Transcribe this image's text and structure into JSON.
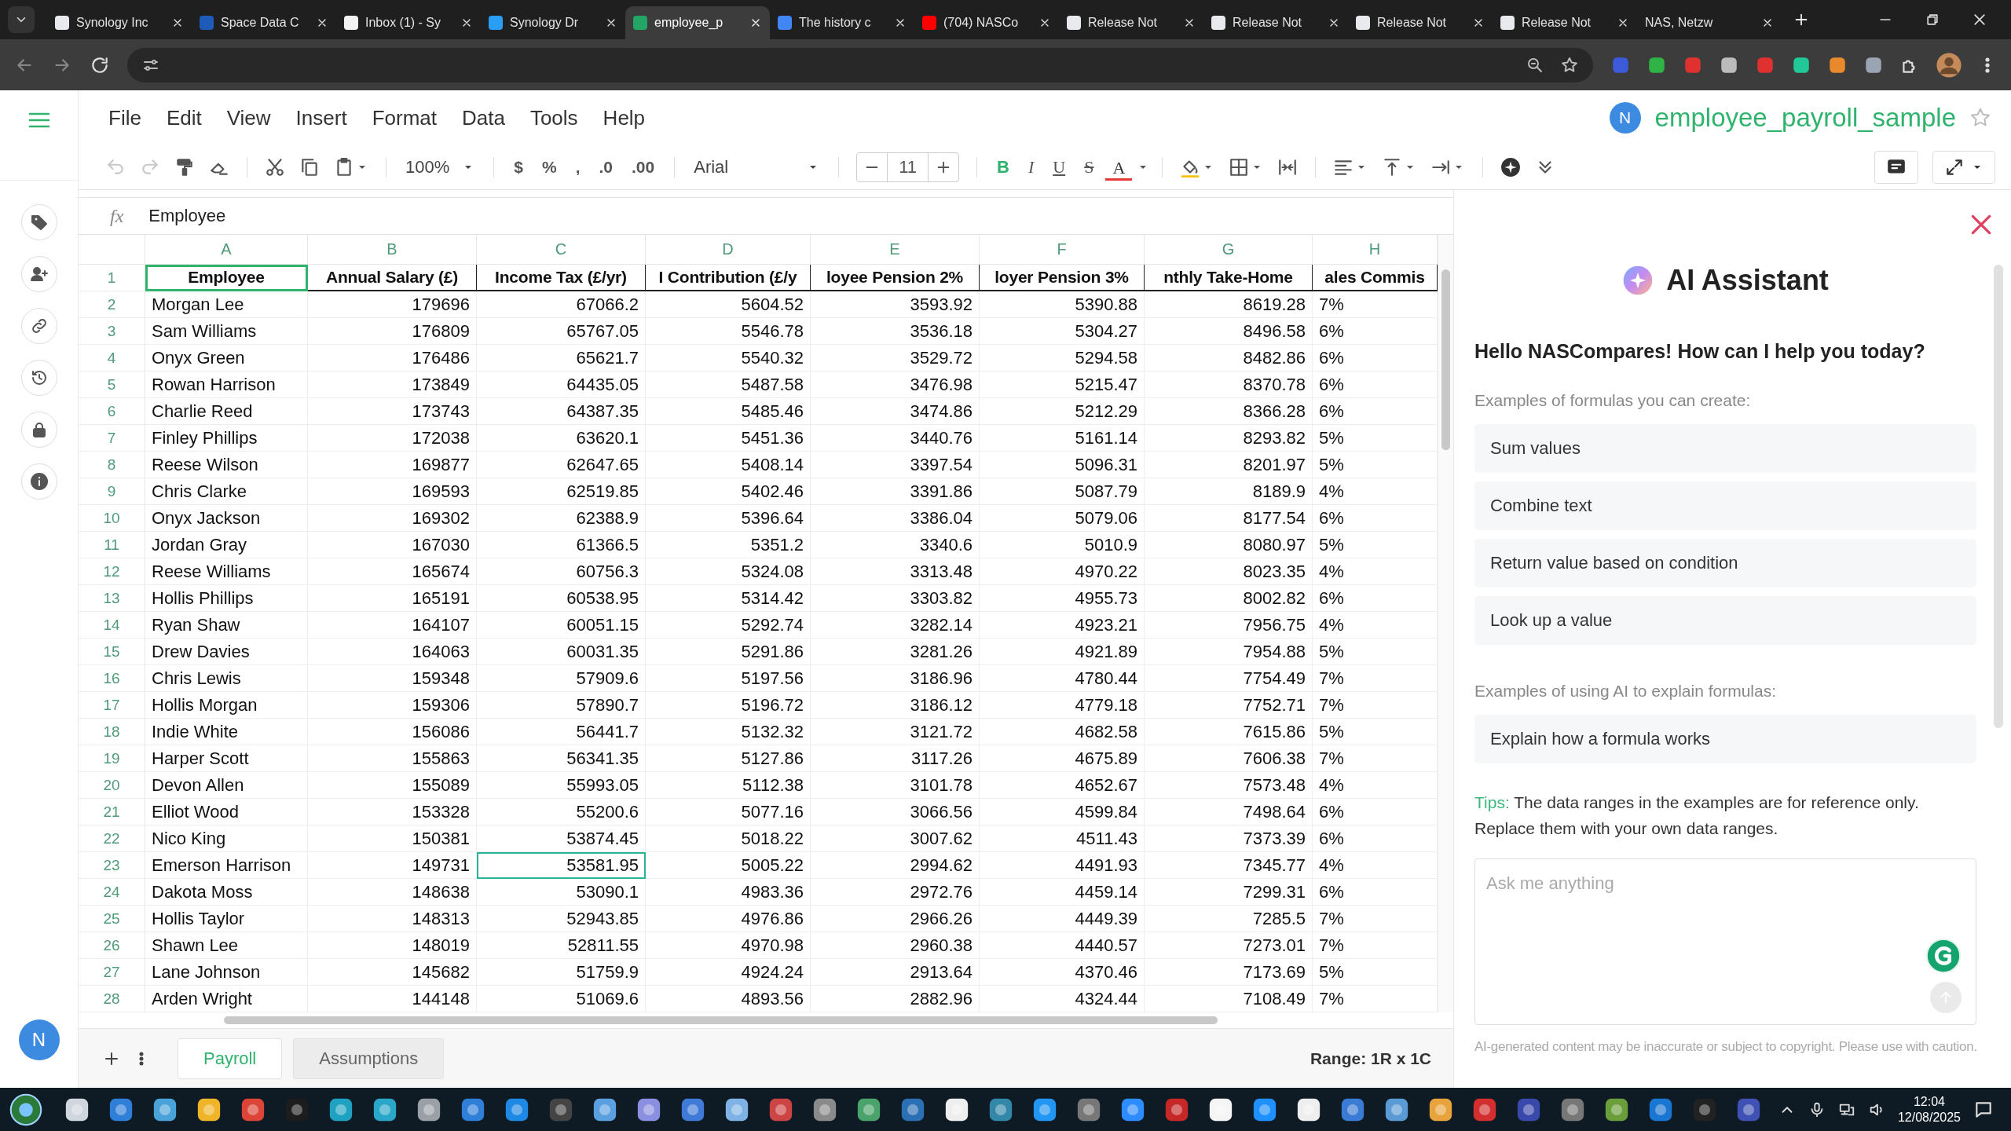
{
  "browser": {
    "tabs": [
      {
        "title": "Synology Inc",
        "selected": false,
        "color": "#e8eaed"
      },
      {
        "title": "Space Data C",
        "selected": false,
        "color": "#1e5bb8"
      },
      {
        "title": "Inbox (1) - Sy",
        "selected": false,
        "color": "#f1f3f4"
      },
      {
        "title": "Synology Dr",
        "selected": false,
        "color": "#2a9ef4"
      },
      {
        "title": "employee_p",
        "selected": true,
        "color": "#23a566"
      },
      {
        "title": "The history c",
        "selected": false,
        "color": "#4285f4"
      },
      {
        "title": "(704) NASCo",
        "selected": false,
        "color": "#ff0000"
      },
      {
        "title": "Release Not",
        "selected": false,
        "color": "#e8eaed"
      },
      {
        "title": "Release Not",
        "selected": false,
        "color": "#e8eaed"
      },
      {
        "title": "Release Not",
        "selected": false,
        "color": "#e8eaed"
      },
      {
        "title": "Release Not",
        "selected": false,
        "color": "#e8eaed"
      },
      {
        "title": "NAS, Netzw",
        "selected": false
      }
    ]
  },
  "app": {
    "menu": [
      "File",
      "Edit",
      "View",
      "Insert",
      "Format",
      "Data",
      "Tools",
      "Help"
    ],
    "rail_user_initial": "N",
    "user_initial": "N",
    "document_title": "employee_payroll_sample",
    "toolbar": {
      "undo": {
        "disabled": true
      },
      "redo": {
        "disabled": true
      },
      "zoom": "100%",
      "number_formats": [
        "$",
        "%",
        ",",
        ".0",
        ".00"
      ],
      "font": "Arial",
      "font_size": "11",
      "styles": [
        "B",
        "I",
        "U",
        "S",
        "A"
      ]
    },
    "formula_bar": {
      "label": "fx",
      "value": "Employee"
    },
    "sheet": {
      "columns": [
        "A",
        "B",
        "C",
        "D",
        "E",
        "F",
        "G",
        "H"
      ],
      "header_row": {
        "number": "1",
        "cells": [
          "Employee",
          "Annual Salary (£)",
          "Income Tax (£/yr)",
          "I Contribution (£/y",
          "loyee Pension 2%",
          "loyer Pension 3%",
          "nthly Take-Home",
          "ales Commis"
        ],
        "selected": [
          true,
          false,
          false,
          false,
          false,
          false,
          false,
          false
        ]
      },
      "rows": [
        {
          "number": "2",
          "cells": [
            "Morgan Lee",
            "179696",
            "67066.2",
            "5604.52",
            "3593.92",
            "5390.88",
            "8619.28",
            "7%"
          ],
          "selected": [
            false,
            false,
            false,
            false,
            false,
            false,
            false,
            false
          ]
        },
        {
          "number": "3",
          "cells": [
            "Sam Williams",
            "176809",
            "65767.05",
            "5546.78",
            "3536.18",
            "5304.27",
            "8496.58",
            "6%"
          ],
          "selected": [
            false,
            false,
            false,
            false,
            false,
            false,
            false,
            false
          ]
        },
        {
          "number": "4",
          "cells": [
            "Onyx Green",
            "176486",
            "65621.7",
            "5540.32",
            "3529.72",
            "5294.58",
            "8482.86",
            "6%"
          ],
          "selected": [
            false,
            false,
            false,
            false,
            false,
            false,
            false,
            false
          ]
        },
        {
          "number": "5",
          "cells": [
            "Rowan Harrison",
            "173849",
            "64435.05",
            "5487.58",
            "3476.98",
            "5215.47",
            "8370.78",
            "6%"
          ],
          "selected": [
            false,
            false,
            false,
            false,
            false,
            false,
            false,
            false
          ]
        },
        {
          "number": "6",
          "cells": [
            "Charlie Reed",
            "173743",
            "64387.35",
            "5485.46",
            "3474.86",
            "5212.29",
            "8366.28",
            "6%"
          ],
          "selected": [
            false,
            false,
            false,
            false,
            false,
            false,
            false,
            false
          ]
        },
        {
          "number": "7",
          "cells": [
            "Finley Phillips",
            "172038",
            "63620.1",
            "5451.36",
            "3440.76",
            "5161.14",
            "8293.82",
            "5%"
          ],
          "selected": [
            false,
            false,
            false,
            false,
            false,
            false,
            false,
            false
          ]
        },
        {
          "number": "8",
          "cells": [
            "Reese Wilson",
            "169877",
            "62647.65",
            "5408.14",
            "3397.54",
            "5096.31",
            "8201.97",
            "5%"
          ],
          "selected": [
            false,
            false,
            false,
            false,
            false,
            false,
            false,
            false
          ]
        },
        {
          "number": "9",
          "cells": [
            "Chris Clarke",
            "169593",
            "62519.85",
            "5402.46",
            "3391.86",
            "5087.79",
            "8189.9",
            "4%"
          ],
          "selected": [
            false,
            false,
            false,
            false,
            false,
            false,
            false,
            false
          ]
        },
        {
          "number": "10",
          "cells": [
            "Onyx Jackson",
            "169302",
            "62388.9",
            "5396.64",
            "3386.04",
            "5079.06",
            "8177.54",
            "6%"
          ],
          "selected": [
            false,
            false,
            false,
            false,
            false,
            false,
            false,
            false
          ]
        },
        {
          "number": "11",
          "cells": [
            "Jordan Gray",
            "167030",
            "61366.5",
            "5351.2",
            "3340.6",
            "5010.9",
            "8080.97",
            "5%"
          ],
          "selected": [
            false,
            false,
            false,
            false,
            false,
            false,
            false,
            false
          ]
        },
        {
          "number": "12",
          "cells": [
            "Reese Williams",
            "165674",
            "60756.3",
            "5324.08",
            "3313.48",
            "4970.22",
            "8023.35",
            "4%"
          ],
          "selected": [
            false,
            false,
            false,
            false,
            false,
            false,
            false,
            false
          ]
        },
        {
          "number": "13",
          "cells": [
            "Hollis Phillips",
            "165191",
            "60538.95",
            "5314.42",
            "3303.82",
            "4955.73",
            "8002.82",
            "6%"
          ],
          "selected": [
            false,
            false,
            false,
            false,
            false,
            false,
            false,
            false
          ]
        },
        {
          "number": "14",
          "cells": [
            "Ryan Shaw",
            "164107",
            "60051.15",
            "5292.74",
            "3282.14",
            "4923.21",
            "7956.75",
            "4%"
          ],
          "selected": [
            false,
            false,
            false,
            false,
            false,
            false,
            false,
            false
          ]
        },
        {
          "number": "15",
          "cells": [
            "Drew Davies",
            "164063",
            "60031.35",
            "5291.86",
            "3281.26",
            "4921.89",
            "7954.88",
            "5%"
          ],
          "selected": [
            false,
            false,
            false,
            false,
            false,
            false,
            false,
            false
          ]
        },
        {
          "number": "16",
          "cells": [
            "Chris Lewis",
            "159348",
            "57909.6",
            "5197.56",
            "3186.96",
            "4780.44",
            "7754.49",
            "7%"
          ],
          "selected": [
            false,
            false,
            false,
            false,
            false,
            false,
            false,
            false
          ]
        },
        {
          "number": "17",
          "cells": [
            "Hollis Morgan",
            "159306",
            "57890.7",
            "5196.72",
            "3186.12",
            "4779.18",
            "7752.71",
            "7%"
          ],
          "selected": [
            false,
            false,
            false,
            false,
            false,
            false,
            false,
            false
          ]
        },
        {
          "number": "18",
          "cells": [
            "Indie White",
            "156086",
            "56441.7",
            "5132.32",
            "3121.72",
            "4682.58",
            "7615.86",
            "5%"
          ],
          "selected": [
            false,
            false,
            false,
            false,
            false,
            false,
            false,
            false
          ]
        },
        {
          "number": "19",
          "cells": [
            "Harper Scott",
            "155863",
            "56341.35",
            "5127.86",
            "3117.26",
            "4675.89",
            "7606.38",
            "7%"
          ],
          "selected": [
            false,
            false,
            false,
            false,
            false,
            false,
            false,
            false
          ]
        },
        {
          "number": "20",
          "cells": [
            "Devon Allen",
            "155089",
            "55993.05",
            "5112.38",
            "3101.78",
            "4652.67",
            "7573.48",
            "4%"
          ],
          "selected": [
            false,
            false,
            false,
            false,
            false,
            false,
            false,
            false
          ]
        },
        {
          "number": "21",
          "cells": [
            "Elliot Wood",
            "153328",
            "55200.6",
            "5077.16",
            "3066.56",
            "4599.84",
            "7498.64",
            "6%"
          ],
          "selected": [
            false,
            false,
            false,
            false,
            false,
            false,
            false,
            false
          ]
        },
        {
          "number": "22",
          "cells": [
            "Nico King",
            "150381",
            "53874.45",
            "5018.22",
            "3007.62",
            "4511.43",
            "7373.39",
            "6%"
          ],
          "selected": [
            false,
            false,
            false,
            false,
            false,
            false,
            false,
            false
          ]
        },
        {
          "number": "23",
          "cells": [
            "Emerson Harrison",
            "149731",
            "53581.95",
            "5005.22",
            "2994.62",
            "4491.93",
            "7345.77",
            "4%"
          ],
          "selected": [
            false,
            false,
            true,
            false,
            false,
            false,
            false,
            false
          ]
        },
        {
          "number": "24",
          "cells": [
            "Dakota Moss",
            "148638",
            "53090.1",
            "4983.36",
            "2972.76",
            "4459.14",
            "7299.31",
            "6%"
          ],
          "selected": [
            false,
            false,
            false,
            false,
            false,
            false,
            false,
            false
          ]
        },
        {
          "number": "25",
          "cells": [
            "Hollis Taylor",
            "148313",
            "52943.85",
            "4976.86",
            "2966.26",
            "4449.39",
            "7285.5",
            "7%"
          ],
          "selected": [
            false,
            false,
            false,
            false,
            false,
            false,
            false,
            false
          ]
        },
        {
          "number": "26",
          "cells": [
            "Shawn Lee",
            "148019",
            "52811.55",
            "4970.98",
            "2960.38",
            "4440.57",
            "7273.01",
            "7%"
          ],
          "selected": [
            false,
            false,
            false,
            false,
            false,
            false,
            false,
            false
          ]
        },
        {
          "number": "27",
          "cells": [
            "Lane Johnson",
            "145682",
            "51759.9",
            "4924.24",
            "2913.64",
            "4370.46",
            "7173.69",
            "5%"
          ],
          "selected": [
            false,
            false,
            false,
            false,
            false,
            false,
            false,
            false
          ]
        },
        {
          "number": "28",
          "cells": [
            "Arden Wright",
            "144148",
            "51069.6",
            "4893.56",
            "2882.96",
            "4324.44",
            "7108.49",
            "7%"
          ],
          "selected": [
            false,
            false,
            false,
            false,
            false,
            false,
            false,
            false
          ]
        }
      ]
    },
    "sheet_tabs": [
      {
        "label": "Payroll",
        "selected": true
      },
      {
        "label": "Assumptions",
        "selected": false
      }
    ],
    "range_info": "Range: 1R x 1C"
  },
  "ai_panel": {
    "title": "AI Assistant",
    "greeting": "Hello NASCompares! How can I help you today?",
    "sections": [
      {
        "label": "Examples of formulas you can create:",
        "items": [
          "Sum values",
          "Combine text",
          "Return value based on condition",
          "Look up a value"
        ]
      },
      {
        "label": "Examples of using AI to explain formulas:",
        "items": [
          "Explain how a formula works"
        ]
      }
    ],
    "tips_label": "Tips:",
    "tips_text": "The data ranges in the examples are for reference only. Replace them with your own data ranges.",
    "input": {
      "placeholder": "Ask me anything"
    },
    "disclaimer": "AI-generated content may be inaccurate or subject to copyright. Please use with caution."
  },
  "taskbar": {
    "time": "12:04",
    "date": "12/08/2025"
  }
}
